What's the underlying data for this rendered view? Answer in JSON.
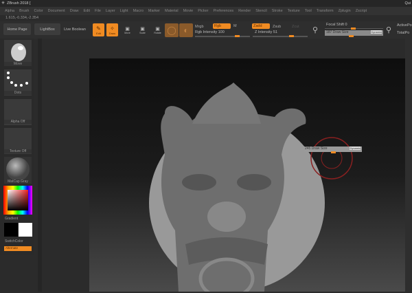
{
  "title": "ZBrush 2018 [",
  "title_right": "Qui",
  "menu": [
    "Alpha",
    "Brush",
    "Color",
    "Document",
    "Draw",
    "Edit",
    "File",
    "Layer",
    "Light",
    "Macro",
    "Marker",
    "Material",
    "Movie",
    "Picker",
    "Preferences",
    "Render",
    "Stencil",
    "Stroke",
    "Texture",
    "Tool",
    "Transform",
    "Zplugin",
    "Zscript"
  ],
  "coords": "1.615,-0.334,-2.354",
  "toolbar": {
    "home": "Home Page",
    "lightbox": "LightBox",
    "live_boolean": "Live Boolean",
    "edit": "Edit",
    "draw": "Draw",
    "move": "Move",
    "scale": "Scale",
    "rotate": "Rotate",
    "mrgb": "Mrgb",
    "rgb": "Rgb",
    "m": "M",
    "rgb_intensity": "Rgb Intensity 100",
    "zadd": "Zadd",
    "zsub": "Zsub",
    "zcut": "Zcut",
    "z_intensity": "Z Intensity 51",
    "focal_shift": "Focal Shift 0",
    "draw_size": "187 Draw Size",
    "dynamic": "Dynamic",
    "active_points": "ActivePo",
    "total_points": "TotalPo"
  },
  "shelf": {
    "brush": "Move",
    "stroke": "Dots",
    "alpha": "Alpha Off",
    "texture": "Texture Off",
    "material": "MatCap Gray",
    "gradient": "Gradient",
    "switch_color": "SwitchColor",
    "alternate": "Alternate"
  },
  "popup": {
    "draw_size": "245 Draw Size",
    "dynamic": "Dynamic"
  },
  "colors": {
    "accent": "#f08b22"
  }
}
